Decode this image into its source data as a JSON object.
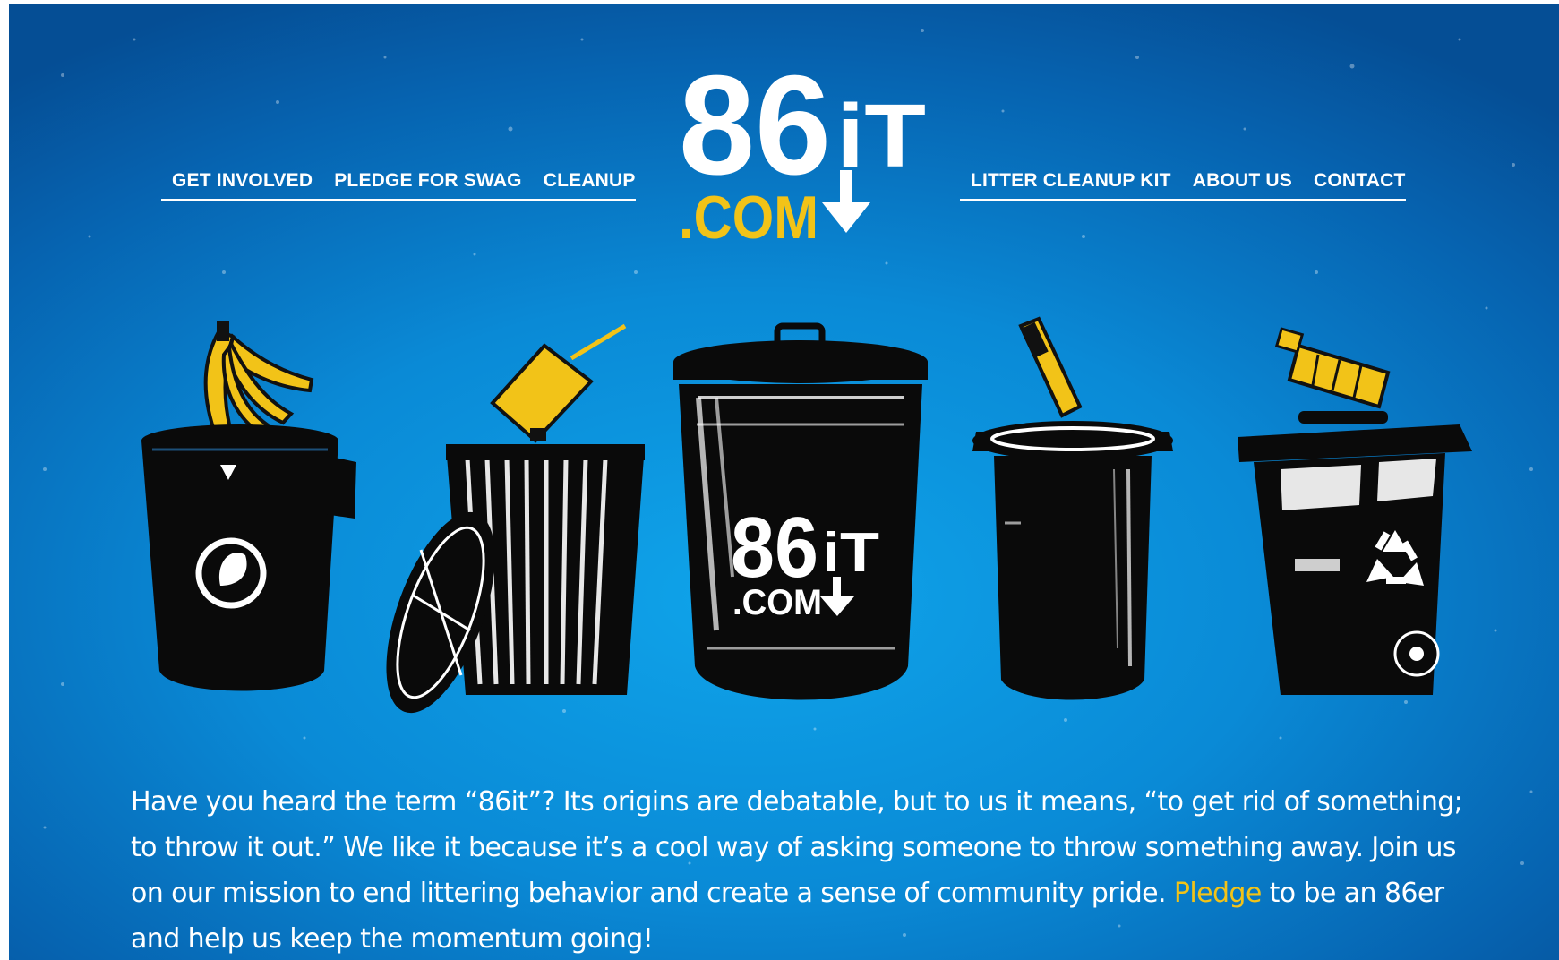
{
  "logo": {
    "number_text": "86",
    "it_text": "iT",
    "com_text": ".COM",
    "bin_number_text": "86",
    "bin_it_text": "iT",
    "bin_com_text": ".COM"
  },
  "nav_left": {
    "get_involved": "GET INVOLVED",
    "pledge_for_swag": "PLEDGE FOR SWAG",
    "cleanup": "CLEANUP"
  },
  "nav_right": {
    "litter_cleanup_kit": "LITTER CLEANUP KIT",
    "about_us": "ABOUT US",
    "contact": "CONTACT"
  },
  "intro": {
    "text_before_link": "Have you heard the term “86it”? Its origins are debatable, but to us it means, “to get rid of something; to throw it out.” We like it because it’s a cool way of asking someone to throw something away. Join us on our mission to end littering behavior and create a sense of community pride. ",
    "link_text": "Pledge",
    "text_after_link": " to be an 86er and help us keep the momentum going!"
  },
  "colors": {
    "background": "#0a8ad6",
    "accent_yellow": "#f2c318",
    "text": "#ffffff",
    "bin_black": "#0a0a0a"
  }
}
